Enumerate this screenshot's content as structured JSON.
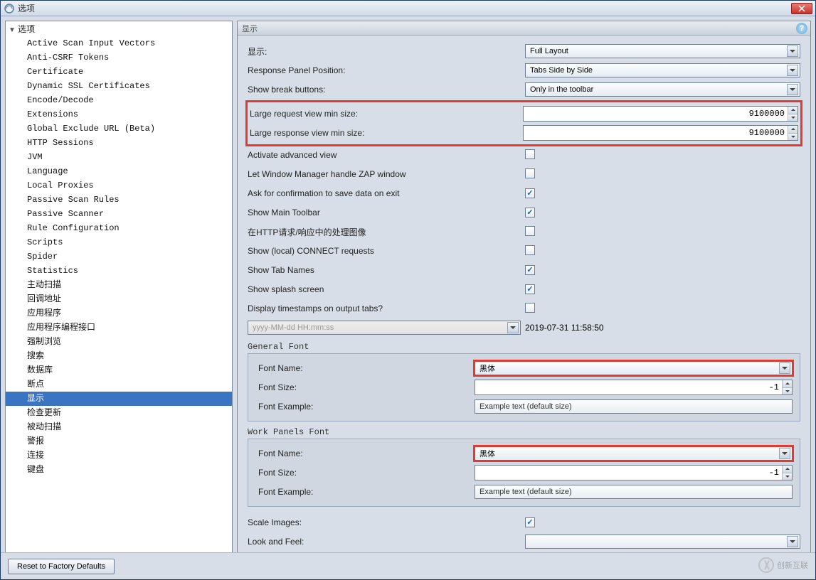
{
  "window": {
    "title": "选项"
  },
  "tree": {
    "root": "选项",
    "items": [
      "Active Scan Input Vectors",
      "Anti-CSRF Tokens",
      "Certificate",
      "Dynamic SSL Certificates",
      "Encode/Decode",
      "Extensions",
      "Global Exclude URL (Beta)",
      "HTTP Sessions",
      "JVM",
      "Language",
      "Local Proxies",
      "Passive Scan Rules",
      "Passive Scanner",
      "Rule Configuration",
      "Scripts",
      "Spider",
      "Statistics",
      "主动扫描",
      "回调地址",
      "应用程序",
      "应用程序编程接口",
      "强制浏览",
      "搜索",
      "数据库",
      "断点",
      "显示",
      "检查更新",
      "被动扫描",
      "警报",
      "连接",
      "键盘"
    ],
    "selected": "显示"
  },
  "panel": {
    "title": "显示",
    "labels": {
      "display": "显示:",
      "response_panel_position": "Response Panel Position:",
      "show_break_buttons": "Show break buttons:",
      "large_request": "Large request view min size:",
      "large_response": "Large response view min size:",
      "activate_advanced": "Activate advanced view",
      "let_wm": "Let Window Manager handle ZAP window",
      "ask_confirm": "Ask for confirmation to save data on exit",
      "show_toolbar": "Show Main Toolbar",
      "http_images": "在HTTP请求/响应中的处理图像",
      "show_connect": "Show (local) CONNECT requests",
      "show_tab_names": "Show Tab Names",
      "show_splash": "Show splash screen",
      "display_timestamps": "Display timestamps on output tabs?",
      "scale_images": "Scale Images:",
      "look_and_feel": "Look and Feel:"
    },
    "values": {
      "display": "Full Layout",
      "response_panel_position": "Tabs Side by Side",
      "show_break_buttons": "Only in the toolbar",
      "large_request": "9100000",
      "large_response": "9100000",
      "timestamp_format": "yyyy-MM-dd HH:mm:ss",
      "timestamp_example": "2019-07-31 11:58:50",
      "look_and_feel": ""
    },
    "checks": {
      "activate_advanced": false,
      "let_wm": false,
      "ask_confirm": true,
      "show_toolbar": true,
      "http_images": false,
      "show_connect": false,
      "show_tab_names": true,
      "show_splash": true,
      "display_timestamps": false,
      "scale_images": true
    },
    "general_font": {
      "group_label": "General Font",
      "font_name_label": "Font Name:",
      "font_name": "黑体",
      "font_size_label": "Font Size:",
      "font_size": "-1",
      "font_example_label": "Font Example:",
      "font_example": "Example text (default size)"
    },
    "work_font": {
      "group_label": "Work Panels Font",
      "font_name_label": "Font Name:",
      "font_name": "黑体",
      "font_size_label": "Font Size:",
      "font_size": "-1",
      "font_example_label": "Font Example:",
      "font_example": "Example text (default size)"
    }
  },
  "footer": {
    "reset": "Reset to Factory Defaults"
  },
  "watermark": "创新互联"
}
